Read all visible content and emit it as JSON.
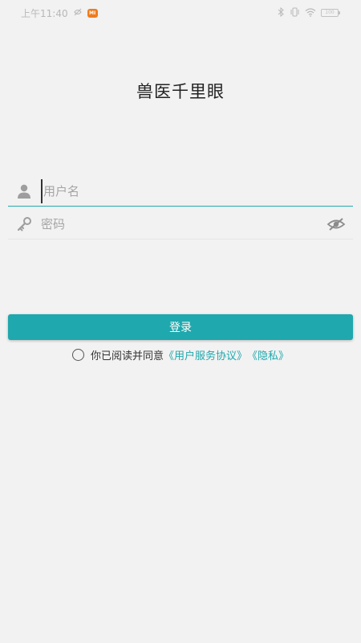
{
  "status_bar": {
    "time": "上午11:40",
    "app_badge": "MI",
    "battery": "100"
  },
  "app": {
    "title": "兽医千里眼"
  },
  "login_form": {
    "username_placeholder": "用户名",
    "password_placeholder": "密码",
    "login_label": "登录"
  },
  "agreement": {
    "prefix": "你已阅读并同意",
    "user_agreement_link": "《用户服务协议》",
    "privacy_link": "《隐私》"
  },
  "colors": {
    "background": "#f2f2f2",
    "accent": "#1fa8ad",
    "title_text": "#222222",
    "placeholder": "#a5a5a5"
  },
  "icons": {
    "username": "person-icon",
    "password": "key-icon",
    "visibility": "eye-off-icon",
    "agree": "radio-unchecked-icon"
  }
}
